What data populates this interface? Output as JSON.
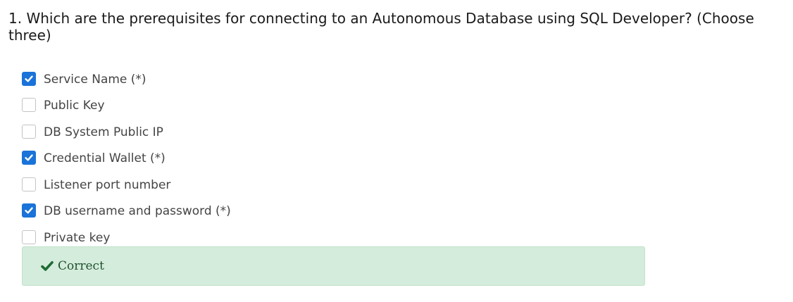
{
  "question": {
    "text": "1. Which are the prerequisites for connecting to an Autonomous Database using SQL Developer? (Choose three)"
  },
  "options": [
    {
      "label": "Service Name (*)",
      "checked": true
    },
    {
      "label": "Public Key",
      "checked": false
    },
    {
      "label": "DB System Public IP",
      "checked": false
    },
    {
      "label": "Credential Wallet (*)",
      "checked": true
    },
    {
      "label": "Listener port number",
      "checked": false
    },
    {
      "label": "DB username and password (*)",
      "checked": true
    },
    {
      "label": "Private key",
      "checked": false
    }
  ],
  "result": {
    "text": "Correct",
    "icon": "check-icon",
    "status": "correct",
    "color": "#1e6b33",
    "background": "#d4ecdb"
  },
  "colors": {
    "checkbox_checked": "#1a73d9",
    "checkbox_border": "#c4c4c4"
  }
}
